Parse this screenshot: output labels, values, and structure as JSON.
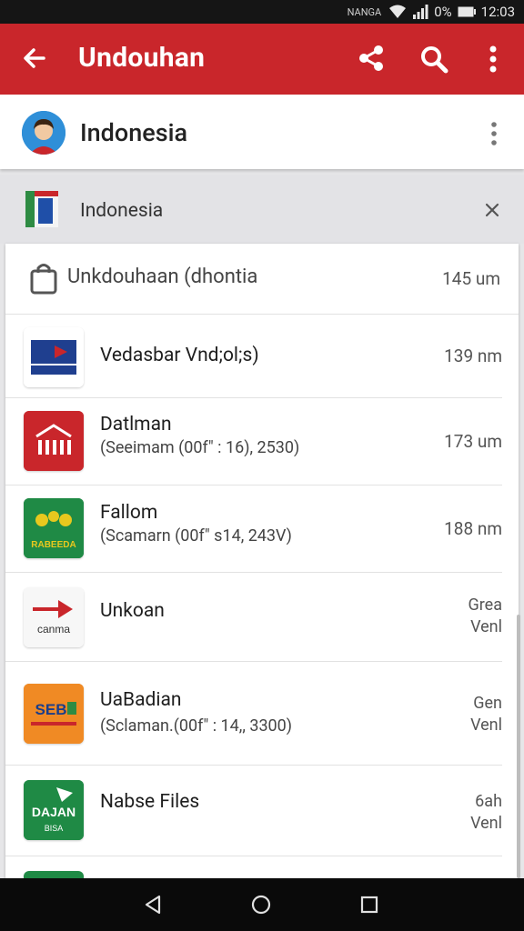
{
  "status_bar": {
    "carrier": "NANGA",
    "battery": "0%",
    "time": "12:03"
  },
  "app_bar": {
    "title": "Undouhan"
  },
  "account": {
    "name": "Indonesia"
  },
  "filter": {
    "label": "Indonesia"
  },
  "card": {
    "title": "Unkdouhaan (dhontia",
    "size": "145 um",
    "items": [
      {
        "title": "Vedasbar Vnd;ol;s)",
        "subtitle": "",
        "size": "139 nm",
        "size2": ""
      },
      {
        "title": "Datlman",
        "subtitle": "(Seeimam (00f\" : 16), 2530)",
        "size": "173 um",
        "size2": ""
      },
      {
        "title": "Fallom",
        "subtitle": "(Scamarn (00f\" s14, 243V)",
        "size": "188 nm",
        "size2": ""
      },
      {
        "title": "Unkoan",
        "subtitle": "",
        "size": "Grea",
        "size2": "Venl"
      },
      {
        "title": "UaBadian",
        "subtitle": "(Sclaman.(00f\" : 14,, 3300)",
        "size": "Gen",
        "size2": "Venl"
      },
      {
        "title": "Nabse Files",
        "subtitle": "",
        "size": "6ah",
        "size2": "Venl"
      }
    ]
  },
  "thumb_text": {
    "i3": "RABEEDA",
    "i4": "canma",
    "i5_top": "SEB",
    "i6_top": "DAJAN",
    "i6_bot": "BISA"
  },
  "colors": {
    "primary": "#c9262b",
    "background": "#e6e6e8"
  }
}
